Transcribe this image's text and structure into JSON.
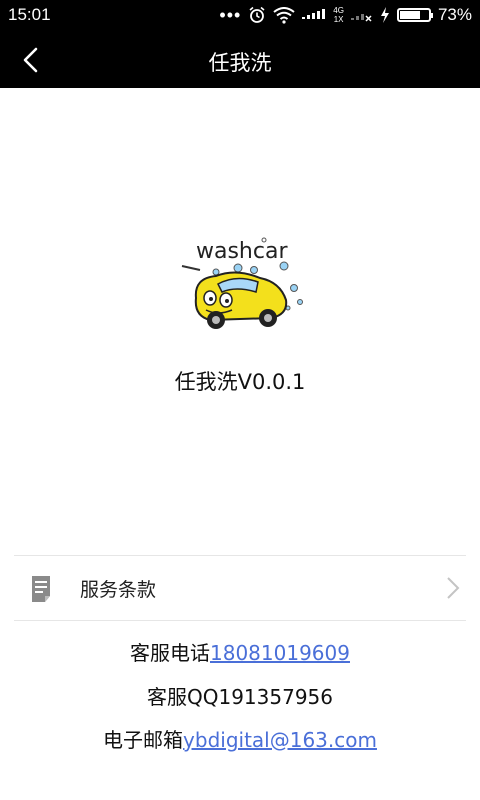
{
  "status_bar": {
    "time": "15:01",
    "dots": "•••",
    "network_top": "4G",
    "network_bottom": "1X",
    "battery_percent": "73%",
    "battery_level": 0.73
  },
  "title_bar": {
    "title": "任我洗"
  },
  "app": {
    "version_text": "任我洗V0.0.1",
    "logo_text": "washcar"
  },
  "menu": {
    "terms_label": "服务条款"
  },
  "contact": {
    "phone_label": "客服电话",
    "phone_number": "18081019609",
    "qq_text": "客服QQ191357956",
    "email_label": "电子邮箱",
    "email_address": "ybdigital@163.com"
  },
  "colors": {
    "bar_bg": "#000000",
    "link": "#4a6fd8",
    "car_yellow": "#f3e01c"
  }
}
